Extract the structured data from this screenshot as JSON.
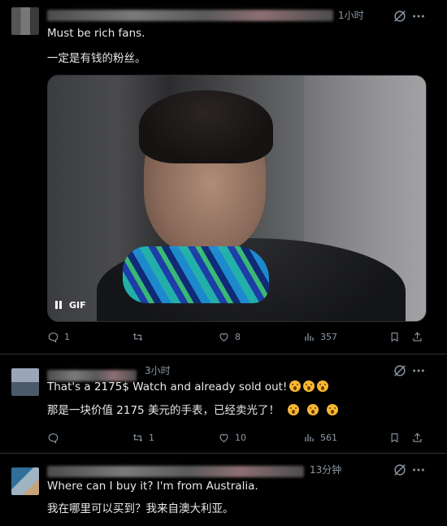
{
  "posts": [
    {
      "time": "1小时",
      "text_en": "Must be rich fans.",
      "text_zh": "一定是有钱的粉丝。",
      "media": {
        "badge": "GIF"
      },
      "actions": {
        "replies": "1",
        "reposts": "",
        "likes": "8",
        "views": "357"
      }
    },
    {
      "time": "3小时",
      "text_en": "That's a 2175$ Watch and already sold out!",
      "text_zh": "那是一块价值 2175 美元的手表，已经卖光了！",
      "actions": {
        "replies": "",
        "reposts": "1",
        "likes": "10",
        "views": "561"
      }
    },
    {
      "time": "13分钟",
      "text_en": "Where can I buy it? I'm from Australia.",
      "text_zh": "我在哪里可以买到？我来自澳大利亚。"
    }
  ],
  "icons": [
    "grok-icon",
    "more-icon",
    "reply-icon",
    "repost-icon",
    "like-icon",
    "views-icon",
    "bookmark-icon",
    "share-icon"
  ]
}
